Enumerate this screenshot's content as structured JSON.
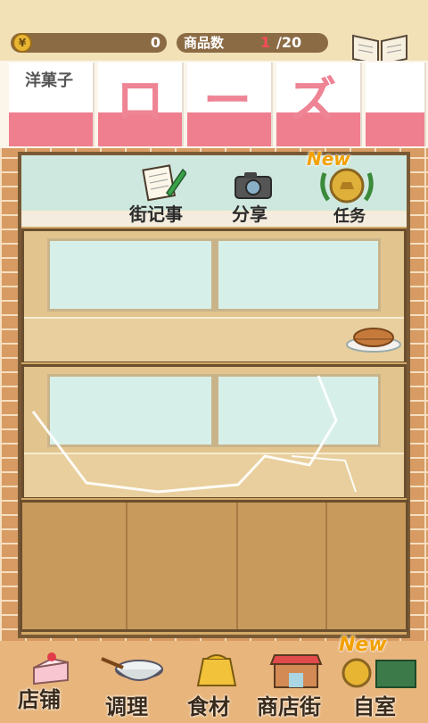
{
  "status": {
    "coin_icon_text": "¥",
    "coins": "0",
    "items_label": "商品数",
    "items_count": "1",
    "items_total": "/20"
  },
  "recipe": {
    "label": "食谱"
  },
  "sign": {
    "small": "洋菓子",
    "big": "ローズ"
  },
  "actions": {
    "diary": "街记事",
    "share": "分享",
    "tasks": "任务",
    "tasks_badge": "New"
  },
  "nav": {
    "shop": "店铺",
    "cook": "调理",
    "ingredients": "食材",
    "street": "商店街",
    "home": "自室",
    "home_badge": "New"
  },
  "colors": {
    "accent_pink": "#ef7f8f",
    "brick": "#d79b63",
    "wood": "#d3a967"
  }
}
